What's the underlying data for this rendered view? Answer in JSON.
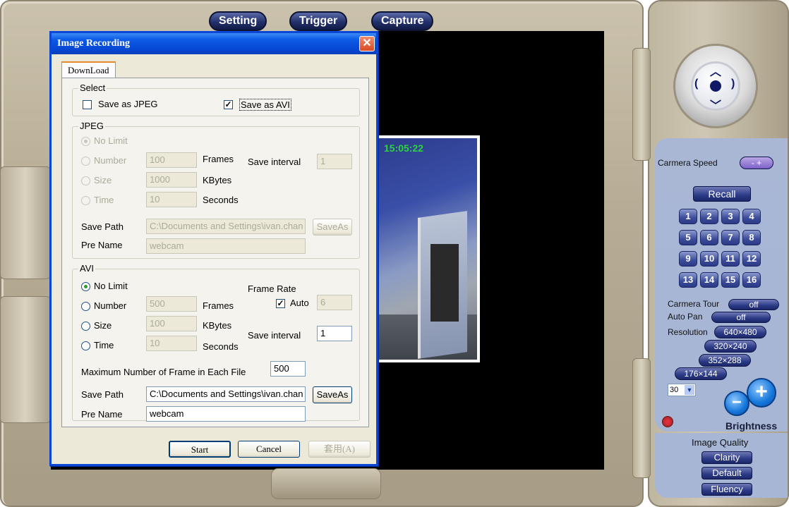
{
  "top_tabs": [
    "Setting",
    "Trigger",
    "Capture"
  ],
  "camera_preview": {
    "timestamp": "15:05:22"
  },
  "dialog": {
    "title": "Image Recording",
    "close_label": "✕",
    "tab": "DownLoad",
    "select": {
      "title": "Select",
      "save_jpeg": {
        "label": "Save as JPEG",
        "checked": false
      },
      "save_avi": {
        "label": "Save as AVI",
        "checked": true
      }
    },
    "jpeg": {
      "title": "JPEG",
      "no_limit": "No Limit",
      "number": "Number",
      "number_value": "100",
      "number_unit": "Frames",
      "size": "Size",
      "size_value": "1000",
      "size_unit": "KBytes",
      "time": "Time",
      "time_value": "10",
      "time_unit": "Seconds",
      "save_interval_label": "Save interval",
      "save_interval_value": "1",
      "save_path_label": "Save Path",
      "save_path_value": "C:\\Documents and Settings\\ivan.chan",
      "save_as": "SaveAs",
      "pre_name_label": "Pre Name",
      "pre_name_value": "webcam"
    },
    "avi": {
      "title": "AVI",
      "no_limit": "No Limit",
      "number": "Number",
      "number_value": "500",
      "number_unit": "Frames",
      "size": "Size",
      "size_value": "100",
      "size_unit": "KBytes",
      "time": "Time",
      "time_value": "10",
      "time_unit": "Seconds",
      "frame_rate_label": "Frame Rate",
      "auto_label": "Auto",
      "auto_checked": true,
      "frame_rate_value": "6",
      "save_interval_label": "Save interval",
      "save_interval_value": "1",
      "max_frames_label": "Maximum Number of Frame in Each File",
      "max_frames_value": "500",
      "save_path_label": "Save Path",
      "save_path_value": "C:\\Documents and Settings\\ivan.chan",
      "save_as": "SaveAs",
      "pre_name_label": "Pre Name",
      "pre_name_value": "webcam"
    },
    "buttons": {
      "start": "Start",
      "cancel": "Cancel",
      "apply": "套用(A)"
    }
  },
  "controls": {
    "camera_speed_label": "Carmera Speed",
    "camera_speed_pill": "- +",
    "recall": "Recall",
    "presets": [
      "1",
      "2",
      "3",
      "4",
      "5",
      "6",
      "7",
      "8",
      "9",
      "10",
      "11",
      "12",
      "13",
      "14",
      "15",
      "16"
    ],
    "camera_tour_label": "Carmera Tour",
    "camera_tour_value": "off",
    "auto_pan_label": "Auto Pan",
    "auto_pan_value": "off",
    "resolution_label": "Resolution",
    "resolutions": [
      "640×480",
      "320×240",
      "352×288",
      "176×144"
    ],
    "fps_value": "30",
    "brightness_label": "Brightness",
    "brightness_minus": "−",
    "brightness_plus": "+",
    "image_quality_label": "Image Quality",
    "quality_options": [
      "Clarity",
      "Default",
      "Fluency"
    ]
  }
}
